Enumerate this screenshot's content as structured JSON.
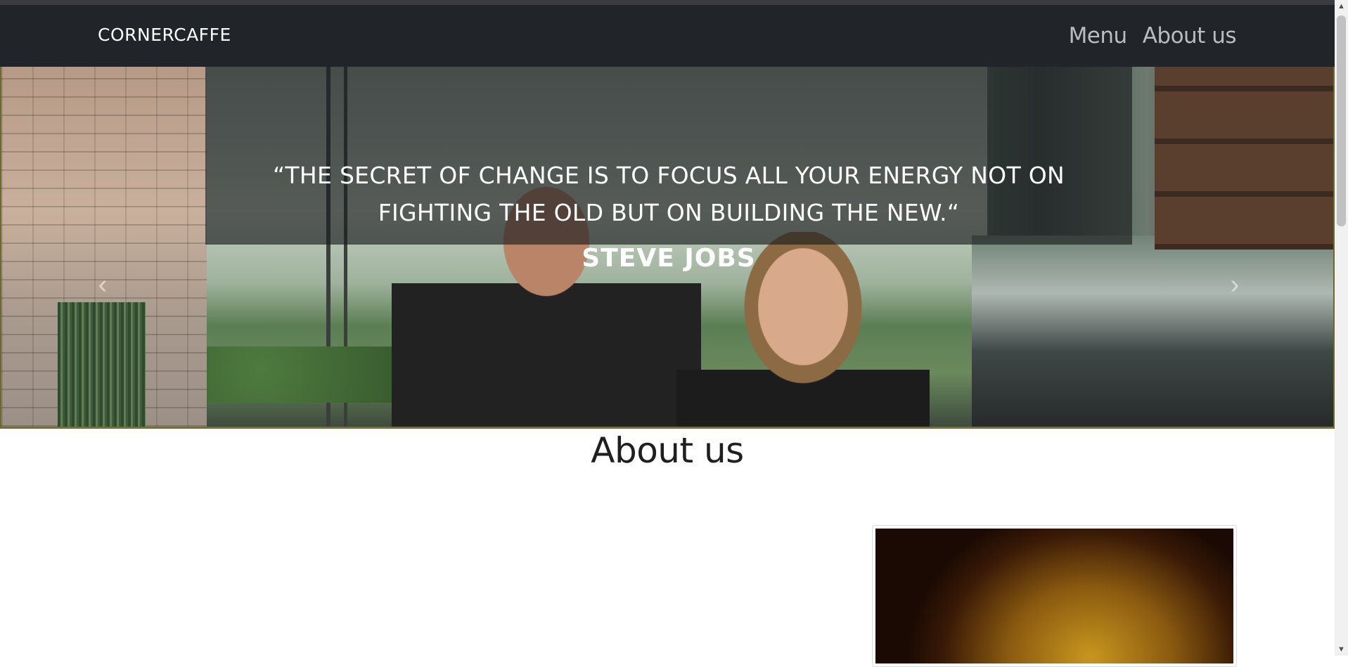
{
  "navbar": {
    "brand": "CORNERCAFFE",
    "links": [
      {
        "label": "Menu"
      },
      {
        "label": "About us"
      }
    ]
  },
  "hero": {
    "quote_line1": "“THE SECRET OF CHANGE IS TO FOCUS ALL YOUR ENERGY NOT ON",
    "quote_line2": "FIGHTING THE OLD BUT ON BUILDING THE NEW.“",
    "author": "STEVE JOBS",
    "prev_icon": "chevron-left-icon",
    "next_icon": "chevron-right-icon",
    "prev_glyph": "‹",
    "next_glyph": "›",
    "slide_count": 3,
    "active_slide": 1
  },
  "about": {
    "title": "About us"
  },
  "colors": {
    "navbar_bg": "#212529",
    "nav_link": "#b9bcc0",
    "hero_border": "#7a7026"
  }
}
